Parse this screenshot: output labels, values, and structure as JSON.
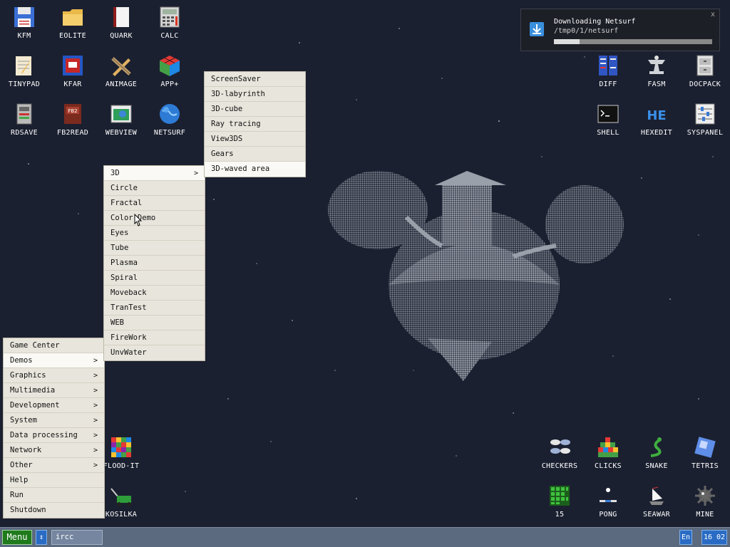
{
  "desktop": {
    "icons": [
      {
        "label": "KFM",
        "icon": "floppy-disk-icon"
      },
      {
        "label": "EOLITE",
        "icon": "folder-icon"
      },
      {
        "label": "QUARK",
        "icon": "book-icon"
      },
      {
        "label": "CALC",
        "icon": "calculator-icon"
      },
      {
        "label": "TINYPAD",
        "icon": "notepad-icon"
      },
      {
        "label": "KFAR",
        "icon": "archive-icon"
      },
      {
        "label": "ANIMAGE",
        "icon": "pencil-ruler-icon"
      },
      {
        "label": "APP+",
        "icon": "rubik-cube-icon"
      },
      {
        "label": "RDSAVE",
        "icon": "ramdisk-save-icon"
      },
      {
        "label": "FB2READ",
        "icon": "fb2-book-icon"
      },
      {
        "label": "WEBVIEW",
        "icon": "webview-icon"
      },
      {
        "label": "NETSURF",
        "icon": "globe-icon"
      },
      {
        "label": "DIFF",
        "icon": "diff-icon"
      },
      {
        "label": "FASM",
        "icon": "anvil-icon"
      },
      {
        "label": "DOCPACK",
        "icon": "cabinet-icon"
      },
      {
        "label": "SHELL",
        "icon": "terminal-icon"
      },
      {
        "label": "HEXEDIT",
        "icon": "hexedit-icon"
      },
      {
        "label": "SYSPANEL",
        "icon": "sliders-icon"
      },
      {
        "label": "FLOOD-IT",
        "icon": "color-grid-icon"
      },
      {
        "label": "KOSILKA",
        "icon": "lawnmower-icon"
      },
      {
        "label": "CHECKERS",
        "icon": "checkers-icon"
      },
      {
        "label": "CLICKS",
        "icon": "blocks-icon"
      },
      {
        "label": "SNAKE",
        "icon": "snake-icon"
      },
      {
        "label": "TETRIS",
        "icon": "tetris-icon"
      },
      {
        "label": "15",
        "icon": "green-grid-icon"
      },
      {
        "label": "PONG",
        "icon": "pong-icon"
      },
      {
        "label": "SEAWAR",
        "icon": "ship-icon"
      },
      {
        "label": "MINE",
        "icon": "mine-icon"
      }
    ]
  },
  "notification": {
    "title": "Downloading Netsurf",
    "path": "/tmp0/1/netsurf",
    "close": "x",
    "progress": 0.16
  },
  "main_menu": {
    "items": [
      {
        "label": "Game Center",
        "arrow": ""
      },
      {
        "label": "Demos",
        "arrow": ">"
      },
      {
        "label": "Graphics",
        "arrow": ">"
      },
      {
        "label": "Multimedia",
        "arrow": ">"
      },
      {
        "label": "Development",
        "arrow": ">"
      },
      {
        "label": "System",
        "arrow": ">"
      },
      {
        "label": "Data processing",
        "arrow": ">"
      },
      {
        "label": "Network",
        "arrow": ">"
      },
      {
        "label": "Other",
        "arrow": ">"
      },
      {
        "label": "Help",
        "arrow": ""
      },
      {
        "label": "Run",
        "arrow": ""
      },
      {
        "label": "Shutdown",
        "arrow": ""
      }
    ],
    "active_index": 1
  },
  "demos_menu": {
    "items": [
      {
        "label": "3D",
        "arrow": ">"
      },
      {
        "label": "Circle",
        "arrow": ""
      },
      {
        "label": "Fractal",
        "arrow": ""
      },
      {
        "label": "Color Demo",
        "arrow": ""
      },
      {
        "label": "Eyes",
        "arrow": ""
      },
      {
        "label": "Tube",
        "arrow": ""
      },
      {
        "label": "Plasma",
        "arrow": ""
      },
      {
        "label": "Spiral",
        "arrow": ""
      },
      {
        "label": "Moveback",
        "arrow": ""
      },
      {
        "label": "TranTest",
        "arrow": ""
      },
      {
        "label": "WEB",
        "arrow": ""
      },
      {
        "label": "FireWork",
        "arrow": ""
      },
      {
        "label": "UnvWater",
        "arrow": ""
      }
    ],
    "active_index": 0
  },
  "menu_3d": {
    "items": [
      {
        "label": "ScreenSaver",
        "arrow": ""
      },
      {
        "label": "3D-labyrinth",
        "arrow": ""
      },
      {
        "label": "3D-cube",
        "arrow": ""
      },
      {
        "label": "Ray tracing",
        "arrow": ""
      },
      {
        "label": "View3DS",
        "arrow": ""
      },
      {
        "label": "Gears",
        "arrow": ""
      },
      {
        "label": "3D-waved area",
        "arrow": ""
      }
    ],
    "active_index": 6
  },
  "taskbar": {
    "menu_label": "Menu",
    "updown_label": "↕",
    "input_value": "ircc",
    "lang": "En",
    "clock": "16 02"
  },
  "colors": {
    "desktop_bg": "#1b2030",
    "menu_bg": "#e8e5dc",
    "taskbar_bg": "#5b6a7e",
    "accent_blue": "#2a6cc4",
    "menu_button_green": "#1f7a1c"
  }
}
